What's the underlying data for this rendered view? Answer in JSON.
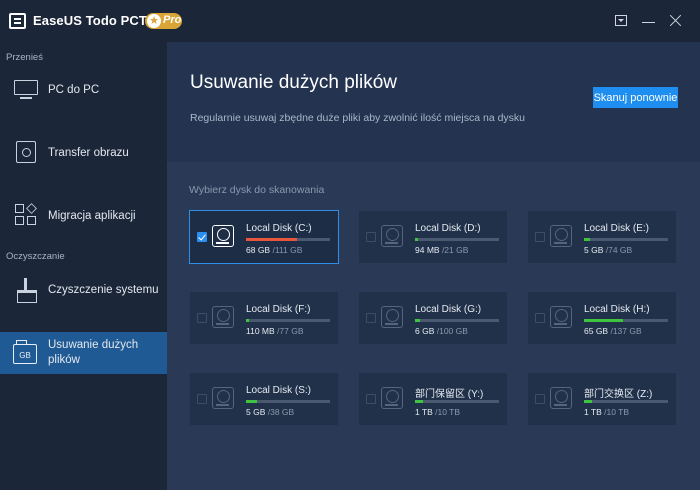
{
  "window": {
    "app_title": "EaseUS Todo PCTrans",
    "badge_label": "Pro",
    "badge_star": "★"
  },
  "sidebar": {
    "section_transfer": "Przenieś",
    "section_cleanup": "Oczyszczanie",
    "items": [
      {
        "label": "PC do PC",
        "icon": "pc-icon"
      },
      {
        "label": "Transfer obrazu",
        "icon": "image-icon"
      },
      {
        "label": "Migracja aplikacji",
        "icon": "apps-icon"
      },
      {
        "label": "Czyszczenie systemu",
        "icon": "broom-icon"
      },
      {
        "label": "Usuwanie dużych plików",
        "icon": "gb-folder-icon",
        "icon_text": "GB",
        "active": true
      }
    ]
  },
  "header": {
    "title": "Usuwanie dużych plików",
    "subtitle": "Regularnie usuwaj zbędne duże pliki aby zwolnić ilość miejsca na dysku",
    "scan_button": "Skanuj ponownie"
  },
  "disks_section": {
    "label": "Wybierz dysk do skanowania",
    "colors": {
      "high_usage": "#e8553d",
      "low_usage": "#3fc43f"
    },
    "disks": [
      {
        "name": "Local Disk (C:)",
        "used": "68 GB",
        "total": " /111 GB",
        "usage": 0.61,
        "color": "#e8553d",
        "selected": true
      },
      {
        "name": "Local Disk (D:)",
        "used": "94 MB",
        "total": " /21 GB",
        "usage": 0.005,
        "color": "#3fc43f",
        "selected": false
      },
      {
        "name": "Local Disk (E:)",
        "used": "5 GB",
        "total": " /74 GB",
        "usage": 0.07,
        "color": "#3fc43f",
        "selected": false
      },
      {
        "name": "Local Disk (F:)",
        "used": "110 MB",
        "total": " /77 GB",
        "usage": 0.002,
        "color": "#3fc43f",
        "selected": false
      },
      {
        "name": "Local Disk (G:)",
        "used": "6 GB",
        "total": " /100 GB",
        "usage": 0.06,
        "color": "#3fc43f",
        "selected": false
      },
      {
        "name": "Local Disk (H:)",
        "used": "65 GB",
        "total": " /137 GB",
        "usage": 0.47,
        "color": "#3fc43f",
        "selected": false
      },
      {
        "name": "Local Disk (S:)",
        "used": "5 GB",
        "total": " /38 GB",
        "usage": 0.13,
        "color": "#3fc43f",
        "selected": false
      },
      {
        "name": "部门保留区 (Y:)",
        "used": "1 TB",
        "total": " /10 TB",
        "usage": 0.1,
        "color": "#3fc43f",
        "selected": false
      },
      {
        "name": "部门交换区 (Z:)",
        "used": "1 TB",
        "total": " /10 TB",
        "usage": 0.1,
        "color": "#3fc43f",
        "selected": false
      }
    ]
  }
}
